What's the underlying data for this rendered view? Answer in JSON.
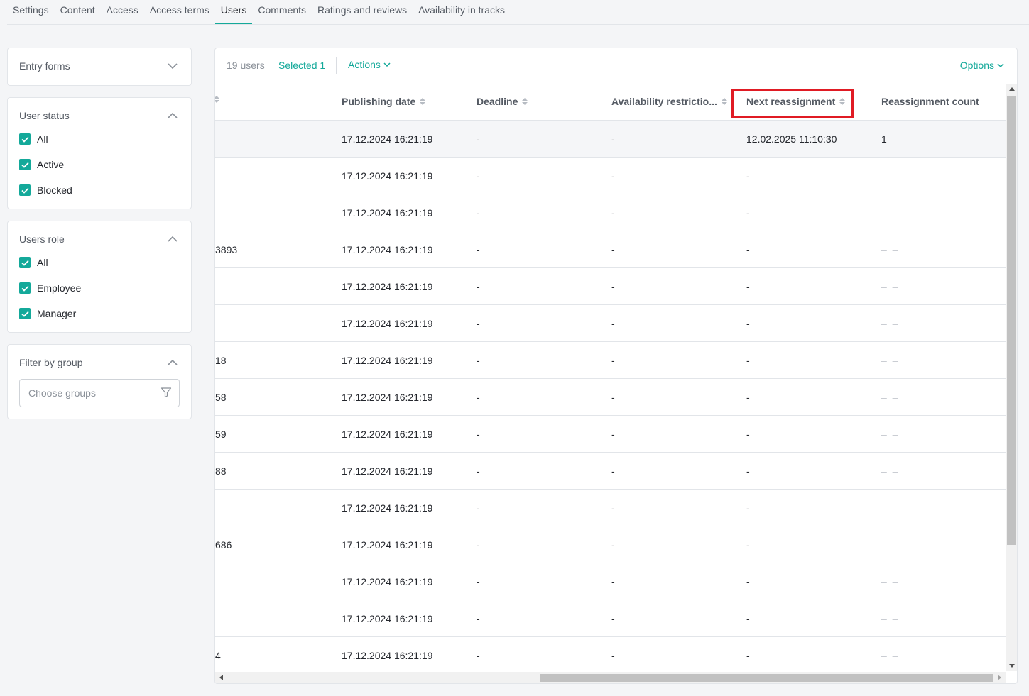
{
  "tabs": [
    {
      "label": "Settings"
    },
    {
      "label": "Content"
    },
    {
      "label": "Access"
    },
    {
      "label": "Access terms"
    },
    {
      "label": "Users",
      "active": true
    },
    {
      "label": "Comments"
    },
    {
      "label": "Ratings and reviews"
    },
    {
      "label": "Availability in tracks"
    }
  ],
  "sidebar": {
    "entry_forms": {
      "title": "Entry forms"
    },
    "user_status": {
      "title": "User status",
      "options": [
        "All",
        "Active",
        "Blocked"
      ]
    },
    "users_role": {
      "title": "Users role",
      "options": [
        "All",
        "Employee",
        "Manager"
      ]
    },
    "filter_group": {
      "title": "Filter by group",
      "placeholder": "Choose groups"
    }
  },
  "toolbar": {
    "count": "19 users",
    "selected": "Selected 1",
    "actions": "Actions",
    "options": "Options"
  },
  "columns": {
    "publishing_date": "Publishing date",
    "deadline": "Deadline",
    "availability": "Availability restrictio...",
    "next_reassignment": "Next reassignment",
    "reassignment_count": "Reassignment count"
  },
  "rows": [
    {
      "name": "",
      "pub": "17.12.2024 16:21:19",
      "deadline": "-",
      "avail": "-",
      "next": "12.02.2025 11:10:30",
      "count": "1",
      "selected": true
    },
    {
      "name": "",
      "pub": "17.12.2024 16:21:19",
      "deadline": "-",
      "avail": "-",
      "next": "-",
      "count": "– –"
    },
    {
      "name": "",
      "pub": "17.12.2024 16:21:19",
      "deadline": "-",
      "avail": "-",
      "next": "-",
      "count": "– –"
    },
    {
      "name": "3893",
      "pub": "17.12.2024 16:21:19",
      "deadline": "-",
      "avail": "-",
      "next": "-",
      "count": "– –"
    },
    {
      "name": "",
      "pub": "17.12.2024 16:21:19",
      "deadline": "-",
      "avail": "-",
      "next": "-",
      "count": "– –"
    },
    {
      "name": "",
      "pub": "17.12.2024 16:21:19",
      "deadline": "-",
      "avail": "-",
      "next": "-",
      "count": "– –"
    },
    {
      "name": "18",
      "pub": "17.12.2024 16:21:19",
      "deadline": "-",
      "avail": "-",
      "next": "-",
      "count": "– –"
    },
    {
      "name": "58",
      "pub": "17.12.2024 16:21:19",
      "deadline": "-",
      "avail": "-",
      "next": "-",
      "count": "– –"
    },
    {
      "name": "59",
      "pub": "17.12.2024 16:21:19",
      "deadline": "-",
      "avail": "-",
      "next": "-",
      "count": "– –"
    },
    {
      "name": "88",
      "pub": "17.12.2024 16:21:19",
      "deadline": "-",
      "avail": "-",
      "next": "-",
      "count": "– –"
    },
    {
      "name": "",
      "pub": "17.12.2024 16:21:19",
      "deadline": "-",
      "avail": "-",
      "next": "-",
      "count": "– –"
    },
    {
      "name": "686",
      "pub": "17.12.2024 16:21:19",
      "deadline": "-",
      "avail": "-",
      "next": "-",
      "count": "– –"
    },
    {
      "name": "",
      "pub": "17.12.2024 16:21:19",
      "deadline": "-",
      "avail": "-",
      "next": "-",
      "count": "– –"
    },
    {
      "name": "",
      "pub": "17.12.2024 16:21:19",
      "deadline": "-",
      "avail": "-",
      "next": "-",
      "count": "– –"
    },
    {
      "name": "4",
      "pub": "17.12.2024 16:21:19",
      "deadline": "-",
      "avail": "-",
      "next": "-",
      "count": "– –"
    }
  ]
}
